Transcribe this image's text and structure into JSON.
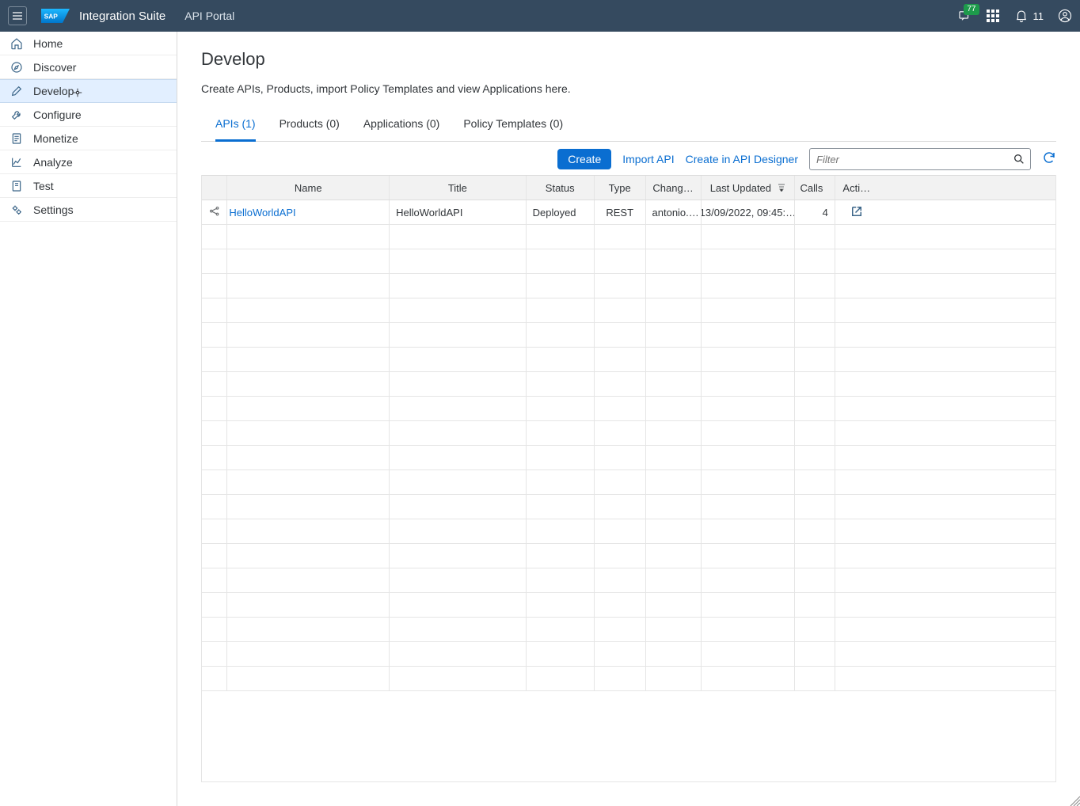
{
  "header": {
    "brand": "Integration Suite",
    "subtitle": "API Portal",
    "cart_badge": "77",
    "notif_count": "11"
  },
  "sidebar": {
    "items": [
      {
        "label": "Home"
      },
      {
        "label": "Discover"
      },
      {
        "label": "Develop"
      },
      {
        "label": "Configure"
      },
      {
        "label": "Monetize"
      },
      {
        "label": "Analyze"
      },
      {
        "label": "Test"
      },
      {
        "label": "Settings"
      }
    ]
  },
  "page": {
    "title": "Develop",
    "desc": "Create APIs, Products, import Policy Templates and view Applications here."
  },
  "tabs": [
    {
      "label": "APIs (1)"
    },
    {
      "label": "Products (0)"
    },
    {
      "label": "Applications (0)"
    },
    {
      "label": "Policy Templates (0)"
    }
  ],
  "toolbar": {
    "create": "Create",
    "import": "Import API",
    "designer": "Create in API Designer",
    "filter_placeholder": "Filter"
  },
  "columns": {
    "name": "Name",
    "title": "Title",
    "status": "Status",
    "type": "Type",
    "changed": "Chang…",
    "updated": "Last Updated",
    "calls": "Calls",
    "actions": "Acti…"
  },
  "rows": [
    {
      "name": "HelloWorldAPI",
      "title": "HelloWorldAPI",
      "status": "Deployed",
      "type": "REST",
      "changed": "antonio.…",
      "updated": "13/09/2022, 09:45:…",
      "calls": "4"
    }
  ]
}
